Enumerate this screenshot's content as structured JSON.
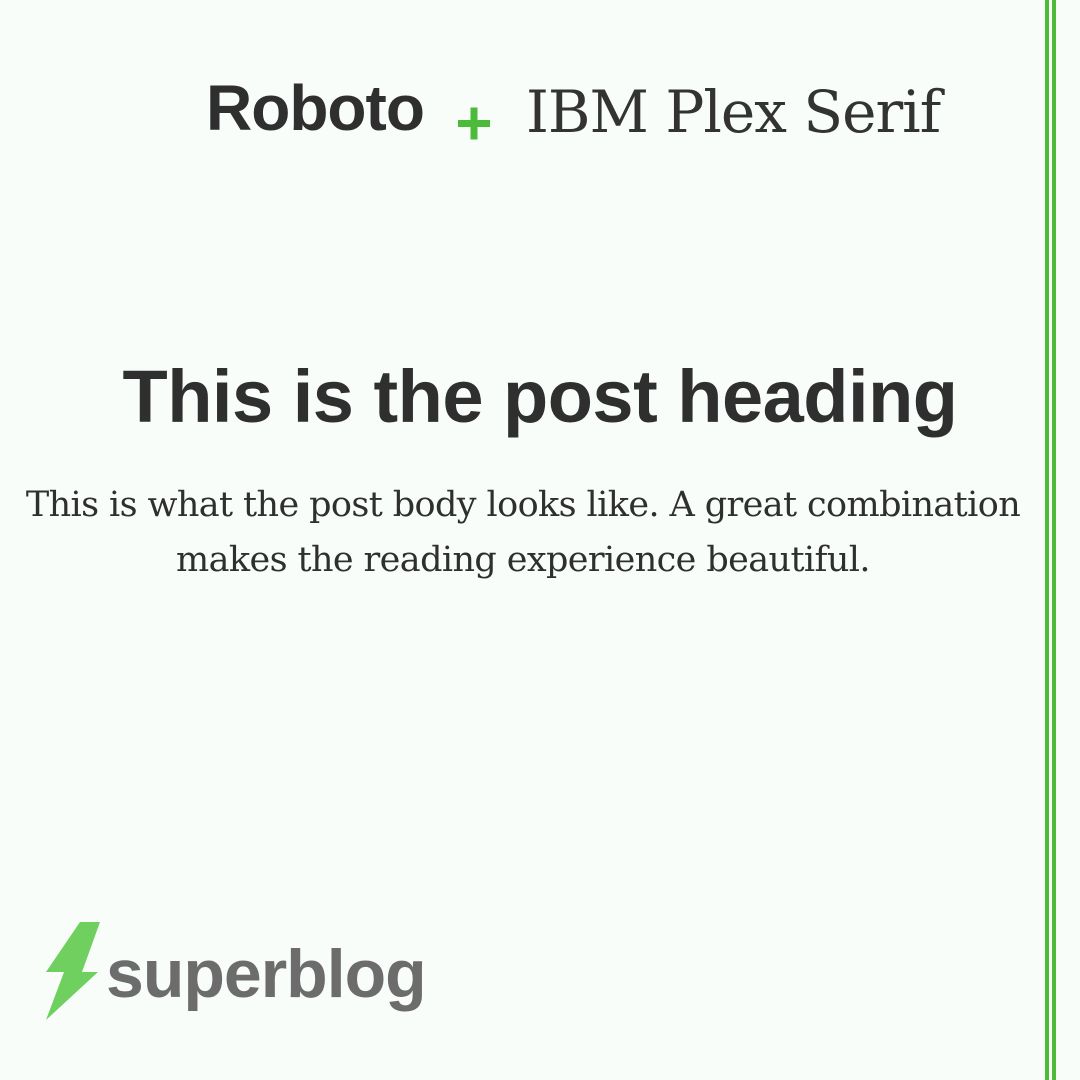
{
  "pairing": {
    "heading_font": "Roboto",
    "separator": "+",
    "body_font": "IBM Plex Serif"
  },
  "post": {
    "heading": "This is the post heading",
    "body": "This is what the post body looks like. A great combination makes the reading experience beautiful."
  },
  "brand": {
    "name": "superblog",
    "icon": "lightning-bolt-icon"
  },
  "colors": {
    "accent": "#4cbb3a",
    "bolt": "#6fcf5f",
    "text": "#2f2f2f",
    "brand_text": "#6c6c6c",
    "background": "#f9fdf9"
  }
}
